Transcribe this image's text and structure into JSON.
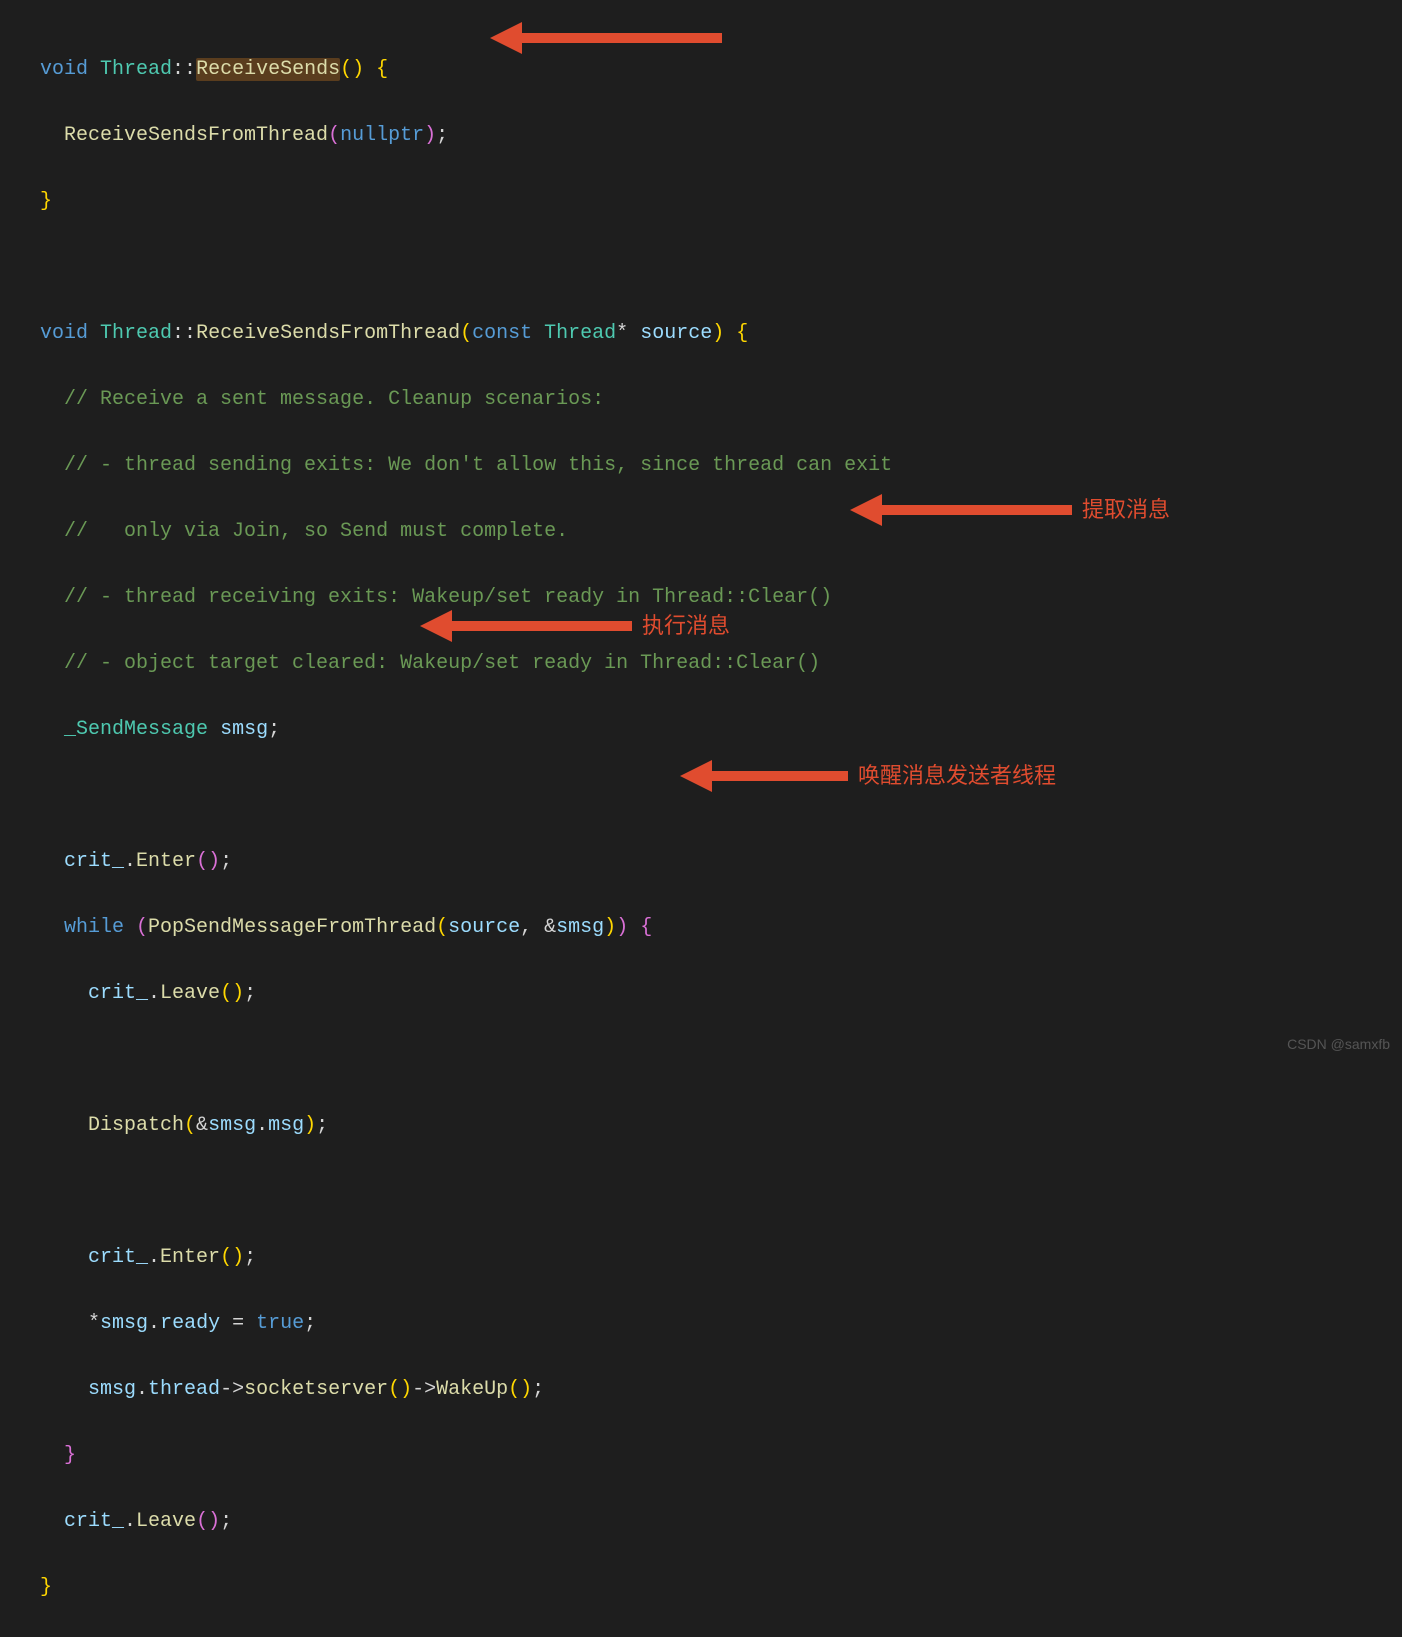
{
  "code": {
    "l1": {
      "kw": "void",
      "cls": "Thread",
      "sep": "::",
      "fn": "ReceiveSends",
      "p1": "()",
      "brace": " {"
    },
    "l2": {
      "fn": "ReceiveSendsFromThread",
      "p1": "(",
      "arg": "nullptr",
      "p2": ")",
      "semi": ";"
    },
    "l3": {
      "brace": "}"
    },
    "l5": {
      "kw": "void",
      "cls": "Thread",
      "sep": "::",
      "fn": "ReceiveSendsFromThread",
      "p1": "(",
      "kw2": "const",
      "cls2": "Thread",
      "star": "*",
      "arg": "source",
      "p2": ")",
      "brace": " {"
    },
    "l6": {
      "c": "// Receive a sent message. Cleanup scenarios:"
    },
    "l7": {
      "c": "// - thread sending exits: We don't allow this, since thread can exit"
    },
    "l8": {
      "c": "//   only via Join, so Send must complete."
    },
    "l9": {
      "c": "// - thread receiving exits: Wakeup/set ready in Thread::Clear()"
    },
    "l10": {
      "c": "// - object target cleared: Wakeup/set ready in Thread::Clear()"
    },
    "l11": {
      "cls": "_SendMessage",
      "var": "smsg",
      "semi": ";"
    },
    "l13": {
      "var": "crit_",
      "dot": ".",
      "fn": "Enter",
      "p": "()",
      "semi": ";"
    },
    "l14": {
      "kw": "while",
      "p1": " (",
      "fn": "PopSendMessageFromThread",
      "p2": "(",
      "a1": "source",
      "comma": ", ",
      "amp": "&",
      "a2": "smsg",
      "p3": ")",
      "p4": ")",
      "brace": " {"
    },
    "l15": {
      "var": "crit_",
      "dot": ".",
      "fn": "Leave",
      "p": "()",
      "semi": ";"
    },
    "l17": {
      "fn": "Dispatch",
      "p1": "(",
      "amp": "&",
      "v1": "smsg",
      "dot": ".",
      "v2": "msg",
      "p2": ")",
      "semi": ";"
    },
    "l19": {
      "var": "crit_",
      "dot": ".",
      "fn": "Enter",
      "p": "()",
      "semi": ";"
    },
    "l20": {
      "star": "*",
      "v1": "smsg",
      "dot": ".",
      "v2": "ready",
      "eq": " = ",
      "val": "true",
      "semi": ";"
    },
    "l21": {
      "v1": "smsg",
      "dot": ".",
      "v2": "thread",
      "arrow": "->",
      "fn1": "socketserver",
      "p1": "()",
      "arrow2": "->",
      "fn2": "WakeUp",
      "p2": "()",
      "semi": ";"
    },
    "l22": {
      "brace": "}"
    },
    "l23": {
      "var": "crit_",
      "dot": ".",
      "fn": "Leave",
      "p": "()",
      "semi": ";"
    },
    "l24": {
      "brace": "}"
    }
  },
  "annotations": {
    "a1": "",
    "a2": "提取消息",
    "a3": "执行消息",
    "a4": "唤醒消息发送者线程"
  },
  "watermark": "CSDN @samxfb"
}
